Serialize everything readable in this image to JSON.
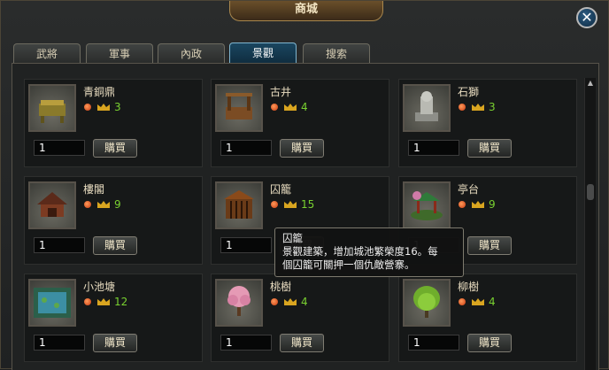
{
  "window": {
    "title": "商城",
    "close_icon": "close-icon"
  },
  "tabs": [
    {
      "label": "武將",
      "active": false
    },
    {
      "label": "軍事",
      "active": false
    },
    {
      "label": "內政",
      "active": false
    },
    {
      "label": "景觀",
      "active": true
    },
    {
      "label": "搜索",
      "active": false
    }
  ],
  "items": [
    {
      "name": "青銅鼎",
      "level": "3",
      "quantity": "1",
      "buy_label": "購買",
      "icon": "bronze-cauldron-icon"
    },
    {
      "name": "古井",
      "level": "4",
      "quantity": "1",
      "buy_label": "購買",
      "icon": "ancient-well-icon"
    },
    {
      "name": "石獅",
      "level": "3",
      "quantity": "1",
      "buy_label": "購買",
      "icon": "stone-lion-icon"
    },
    {
      "name": "樓閣",
      "level": "9",
      "quantity": "1",
      "buy_label": "購買",
      "icon": "pavilion-building-icon"
    },
    {
      "name": "囚籠",
      "level": "15",
      "quantity": "1",
      "buy_label": "購買",
      "icon": "prison-cage-icon"
    },
    {
      "name": "亭台",
      "level": "9",
      "quantity": "1",
      "buy_label": "購買",
      "icon": "gazebo-icon"
    },
    {
      "name": "小池塘",
      "level": "12",
      "quantity": "1",
      "buy_label": "購買",
      "icon": "pond-icon"
    },
    {
      "name": "桃樹",
      "level": "4",
      "quantity": "1",
      "buy_label": "購買",
      "icon": "peach-tree-icon"
    },
    {
      "name": "柳樹",
      "level": "4",
      "quantity": "1",
      "buy_label": "購買",
      "icon": "willow-tree-icon"
    }
  ],
  "tooltip": {
    "title": "囚籠",
    "line1": "景觀建築，增加城池繁榮度16。每",
    "line2": "個囚籠可關押一個仇敵營寨。"
  },
  "colors": {
    "level_text": "#79d130",
    "active_tab": "#1a4660",
    "gold": "#d9a520"
  }
}
